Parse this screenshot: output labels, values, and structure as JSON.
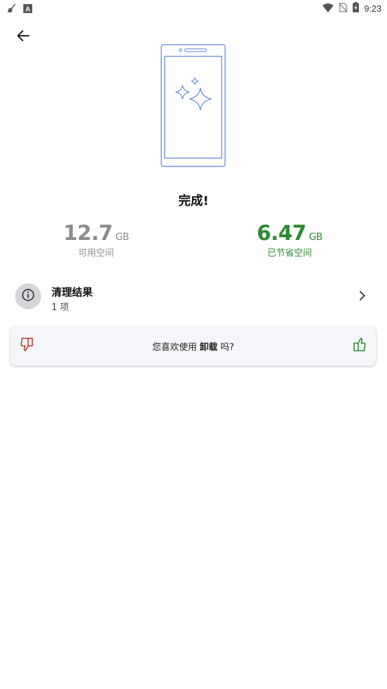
{
  "status_bar": {
    "time": "9:23",
    "icons": [
      "broom-icon",
      "a-box-icon",
      "wifi-icon",
      "no-sim-icon",
      "battery-charging-icon"
    ]
  },
  "header": {
    "back_icon": "arrow-left-icon"
  },
  "illustration": {
    "icon": "phone-sparkles-icon"
  },
  "done": {
    "title": "完成!"
  },
  "stats": {
    "free": {
      "value": "12.7",
      "unit": "GB",
      "label": "可用空间"
    },
    "saved": {
      "value": "6.47",
      "unit": "GB",
      "label": "已节省空间"
    }
  },
  "results": {
    "title": "清理结果",
    "subtitle": "1 项"
  },
  "feedback": {
    "prefix": "您喜欢使用",
    "app_name": "卸载",
    "suffix": "吗?"
  },
  "colors": {
    "accent_green": "#2e8b34",
    "dislike_red": "#c0392b",
    "illustration_blue": "#5b7fd6",
    "muted_gray": "#8a8c91"
  }
}
